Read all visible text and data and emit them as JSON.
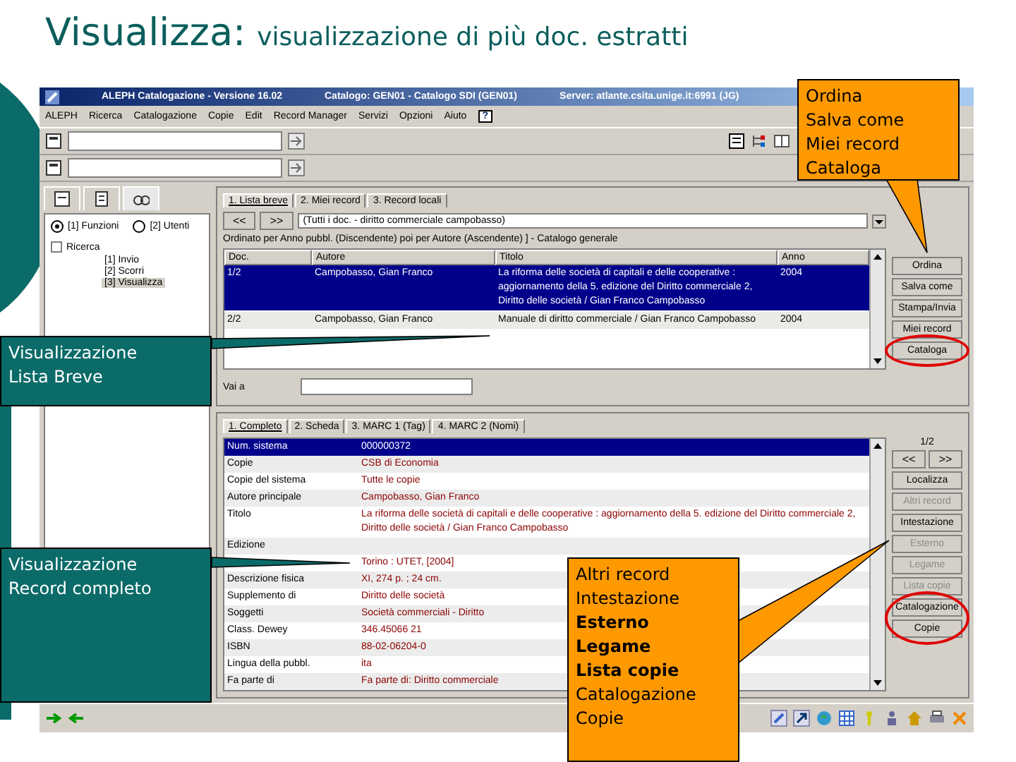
{
  "slide": {
    "title": "Visualizza:",
    "subtitle": "visualizzazione di più doc. estratti"
  },
  "window": {
    "title": "ALEPH Catalogazione - Versione 16.02",
    "catalog": "Catalogo: GEN01 - Catalogo SDI (GEN01)",
    "server": "Server: atlante.csita.unige.it:6991 (JG)"
  },
  "menu": [
    "ALEPH",
    "Ricerca",
    "Catalogazione",
    "Copie",
    "Edit",
    "Record Manager",
    "Servizi",
    "Opzioni",
    "Aiuto",
    "?"
  ],
  "left_panel": {
    "tabs": [
      {
        "selected": false
      },
      {
        "selected": false
      },
      {
        "selected": true
      }
    ],
    "radios": [
      {
        "label": "[1] Funzioni",
        "selected": true
      },
      {
        "label": "[2] Utenti",
        "selected": false
      }
    ],
    "tree": [
      {
        "label": "Ricerca",
        "expanded": true,
        "children": [
          {
            "label": "[1] Invio",
            "selected": false
          },
          {
            "label": "[2] Scorri",
            "selected": false
          },
          {
            "label": "[3] Visualizza",
            "selected": true
          }
        ]
      }
    ]
  },
  "short_list": {
    "tabs": [
      {
        "label": "1. Lista breve",
        "selected": true
      },
      {
        "label": "2. Miei record",
        "selected": false
      },
      {
        "label": "3. Record locali",
        "selected": false
      }
    ],
    "nav": [
      "<<",
      ">>"
    ],
    "query": "(Tutti i doc. - diritto commerciale campobasso)",
    "sort": "Ordinato per Anno pubbl. (Discendente) poi per Autore (Ascendente) ] - Catalogo generale",
    "columns": [
      "Doc.",
      "Autore",
      "Titolo",
      "Anno"
    ],
    "rows": [
      {
        "doc": "1/2",
        "author": "Campobasso, Gian Franco",
        "title": "La riforma delle società di capitali e delle cooperative : aggiornamento della 5. edizione del Diritto commerciale 2, Diritto delle società / Gian Franco Campobasso",
        "year": "2004",
        "selected": true
      },
      {
        "doc": "2/2",
        "author": "Campobasso, Gian Franco",
        "title": "Manuale di diritto commerciale / Gian Franco Campobasso",
        "year": "2004",
        "selected": false
      }
    ],
    "buttons": [
      {
        "label": "Ordina",
        "circled": false
      },
      {
        "label": "Salva come",
        "circled": false
      },
      {
        "label": "Stampa/Invia",
        "circled": false
      },
      {
        "label": "Miei record",
        "circled": false
      },
      {
        "label": "Cataloga",
        "circled": true
      }
    ],
    "goto_label": "Vai a"
  },
  "full_record": {
    "tabs": [
      {
        "label": "1. Completo",
        "selected": true
      },
      {
        "label": "2. Scheda",
        "selected": false
      },
      {
        "label": "3. MARC 1 (Tag)",
        "selected": false
      },
      {
        "label": "4. MARC 2 (Nomi)",
        "selected": false
      }
    ],
    "counter": "1/2",
    "nav": [
      "<<",
      ">>"
    ],
    "rows": [
      {
        "label": "Num. sistema",
        "value": "000000372",
        "selected": true
      },
      {
        "label": "Copie",
        "value": "CSB di Economia",
        "selected": false
      },
      {
        "label": "Copie del sistema",
        "value": "Tutte le copie",
        "selected": false
      },
      {
        "label": "Autore principale",
        "value": "Campobasso, Gian Franco",
        "selected": false
      },
      {
        "label": "Titolo",
        "value": "La riforma delle società di capitali e delle cooperative : aggiornamento della 5. edizione del Diritto commerciale 2, Diritto delle società / Gian Franco Campobasso",
        "selected": false
      },
      {
        "label": "Edizione",
        "value": "",
        "selected": false
      },
      {
        "label": "",
        "value": "Torino : UTET, [2004]",
        "selected": false
      },
      {
        "label": "Descrizione fisica",
        "value": "XI, 274 p. ; 24 cm.",
        "selected": false
      },
      {
        "label": "Supplemento di",
        "value": "Diritto delle società",
        "selected": false
      },
      {
        "label": "Soggetti",
        "value": "Società commerciali - Diritto",
        "selected": false
      },
      {
        "label": "Class. Dewey",
        "value": "346.45066 21",
        "selected": false
      },
      {
        "label": "ISBN",
        "value": "88-02-06204-0",
        "selected": false
      },
      {
        "label": "Lingua della pubbl.",
        "value": "ita",
        "selected": false
      },
      {
        "label": "Fa parte di",
        "value": "Fa parte di: Diritto commerciale",
        "selected": false
      }
    ],
    "buttons": [
      {
        "label": "Localizza",
        "disabled": false,
        "circled": false
      },
      {
        "label": "Altri record",
        "disabled": true,
        "circled": false
      },
      {
        "label": "Intestazione",
        "disabled": false,
        "circled": false
      },
      {
        "label": "Esterno",
        "disabled": true,
        "circled": false
      },
      {
        "label": "Legame",
        "disabled": true,
        "circled": false
      },
      {
        "label": "Lista copie",
        "disabled": true,
        "circled": false
      },
      {
        "label": "Catalogazione",
        "disabled": false,
        "circled": true
      },
      {
        "label": "Copie",
        "disabled": false,
        "circled": true
      }
    ]
  },
  "callouts": [
    {
      "kind": "note",
      "lines": [
        {
          "text": "Ordina",
          "bold": false
        },
        {
          "text": "Salva come",
          "bold": false
        },
        {
          "text": "Miei record",
          "bold": false
        },
        {
          "text": "Cataloga",
          "bold": false
        }
      ]
    },
    {
      "kind": "label",
      "lines": [
        {
          "text": "Visualizzazione",
          "bold": false
        },
        {
          "text": "Lista Breve",
          "bold": false
        }
      ]
    },
    {
      "kind": "label",
      "lines": [
        {
          "text": "Visualizzazione",
          "bold": false
        },
        {
          "text": "Record completo",
          "bold": false
        }
      ]
    },
    {
      "kind": "note",
      "lines": [
        {
          "text": "Altri record",
          "bold": false
        },
        {
          "text": "Intestazione",
          "bold": false
        },
        {
          "text": "Esterno",
          "bold": true
        },
        {
          "text": "Legame",
          "bold": true
        },
        {
          "text": "Lista copie",
          "bold": true
        },
        {
          "text": "Catalogazione",
          "bold": false
        },
        {
          "text": "Copie",
          "bold": false
        }
      ]
    }
  ]
}
